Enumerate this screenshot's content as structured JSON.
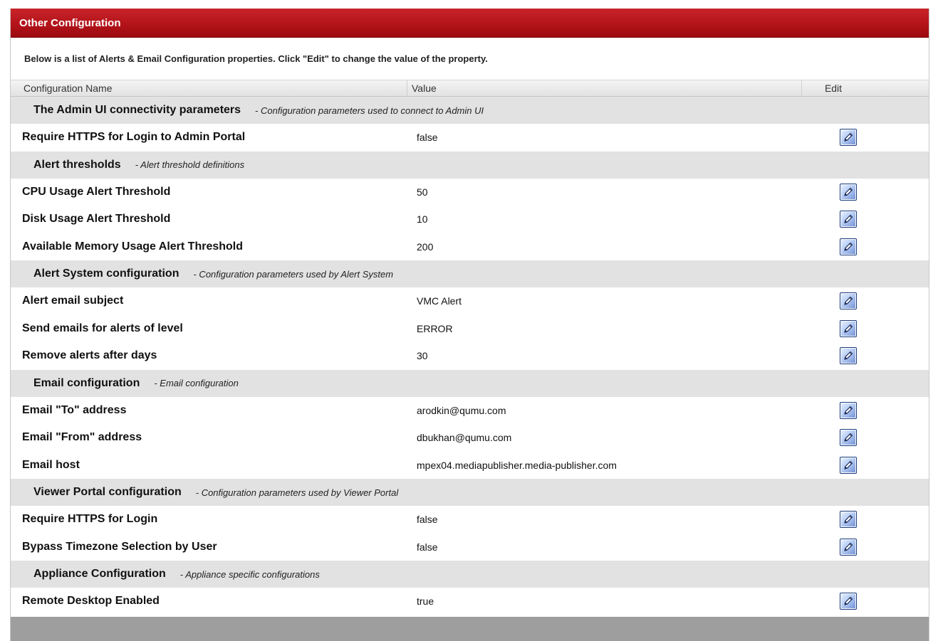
{
  "panel": {
    "title": "Other Configuration",
    "description": "Below is a list of Alerts & Email Configuration properties. Click \"Edit\" to change the value of the property."
  },
  "columns": {
    "name": "Configuration Name",
    "value": "Value",
    "edit": "Edit"
  },
  "groups": [
    {
      "name": "The Admin UI connectivity parameters",
      "description": "- Configuration parameters used to connect to Admin UI",
      "properties": [
        {
          "name": "Require HTTPS for Login to Admin Portal",
          "value": "false"
        }
      ]
    },
    {
      "name": "Alert thresholds",
      "description": "- Alert threshold definitions",
      "properties": [
        {
          "name": "CPU Usage Alert Threshold",
          "value": "50"
        },
        {
          "name": "Disk Usage Alert Threshold",
          "value": "10"
        },
        {
          "name": "Available Memory Usage Alert Threshold",
          "value": "200"
        }
      ]
    },
    {
      "name": "Alert System configuration",
      "description": "- Configuration parameters used by Alert System",
      "properties": [
        {
          "name": "Alert email subject",
          "value": "VMC Alert"
        },
        {
          "name": "Send emails for alerts of level",
          "value": "ERROR"
        },
        {
          "name": "Remove alerts after days",
          "value": "30"
        }
      ]
    },
    {
      "name": "Email configuration",
      "description": "- Email configuration",
      "properties": [
        {
          "name": "Email \"To\" address",
          "value": "arodkin@qumu.com"
        },
        {
          "name": "Email \"From\" address",
          "value": "dbukhan@qumu.com"
        },
        {
          "name": "Email host",
          "value": "mpex04.mediapublisher.media-publisher.com"
        }
      ]
    },
    {
      "name": "Viewer Portal configuration",
      "description": "- Configuration parameters used by Viewer Portal",
      "properties": [
        {
          "name": "Require HTTPS for Login",
          "value": "false"
        },
        {
          "name": "Bypass Timezone Selection by User",
          "value": "false"
        }
      ]
    },
    {
      "name": "Appliance Configuration",
      "description": "- Appliance specific configurations",
      "properties": [
        {
          "name": "Remote Desktop Enabled",
          "value": "true"
        }
      ]
    }
  ],
  "icons": {
    "edit": "pencil-icon"
  },
  "colors": {
    "title_bar": "#b3141a",
    "group_row": "#e2e2e2",
    "footer_bar": "#9e9e9e"
  }
}
